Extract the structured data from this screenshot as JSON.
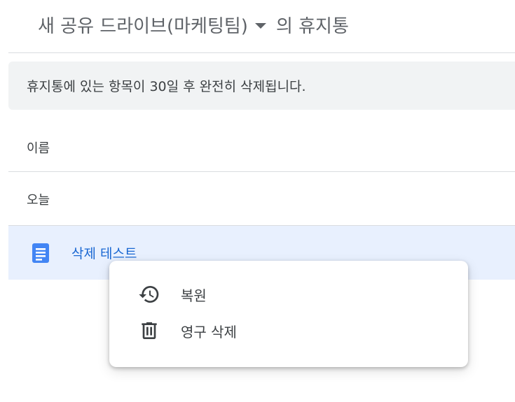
{
  "header": {
    "drive_name": "새 공유 드라이브(마케팅팀)",
    "suffix": "의 휴지통"
  },
  "banner": {
    "text": "휴지통에 있는 항목이 30일 후 완전히 삭제됩니다."
  },
  "list": {
    "column_name": "이름",
    "group_label": "오늘",
    "files": [
      {
        "name": "삭제 테스트",
        "icon": "google-docs-icon"
      }
    ]
  },
  "context_menu": {
    "items": [
      {
        "label": "복원",
        "icon": "restore-history-icon"
      },
      {
        "label": "영구 삭제",
        "icon": "trash-icon"
      }
    ]
  },
  "colors": {
    "accent": "#1967d2",
    "doc_icon": "#4285f4",
    "selected_row": "#e8f0fe",
    "banner_bg": "#f1f3f4"
  }
}
